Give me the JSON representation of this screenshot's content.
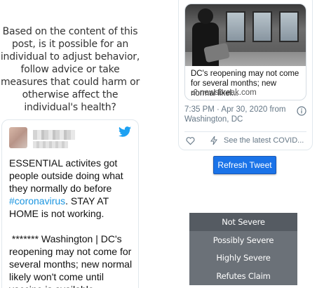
{
  "question": {
    "text": "Based on the content of this post, is it possible for an individual to adjust behavior, follow advice or take measures that could harm or otherwise affect the individual's health?"
  },
  "left_tweet": {
    "text_before": "ESSENTIAL activites got people outside doing what they normally do before ",
    "hashtag": "#coronavirus",
    "text_after": ". STAY AT HOME is not working.\n\n ******* Washington | DC's reopening may not come for several months; new normal likely won't come until vaccine is available",
    "icon": "twitter-bird-icon"
  },
  "right_tweet": {
    "card_title": "DC's reopening may not come for several months; new normal likel...",
    "card_domain": "newsbreak.com",
    "timestamp": "7:35 PM · Apr 30, 2020 from Washington, DC",
    "see_latest": "See the latest COVID...",
    "icons": [
      "link-icon",
      "info-icon",
      "heart-icon",
      "bolt-icon"
    ]
  },
  "refresh_button": {
    "label": "Refresh Tweet"
  },
  "severity_menu": {
    "options": [
      {
        "label": "Not Severe",
        "selected": true
      },
      {
        "label": "Possibly Severe",
        "selected": false
      },
      {
        "label": "Highly Severe",
        "selected": false
      },
      {
        "label": "Refutes Claim",
        "selected": false
      }
    ]
  },
  "colors": {
    "twitter_blue": "#1da1f2",
    "hashtag_blue": "#1b95e0",
    "button_blue": "#1a73e8",
    "menu_gray": "#6b7178"
  }
}
